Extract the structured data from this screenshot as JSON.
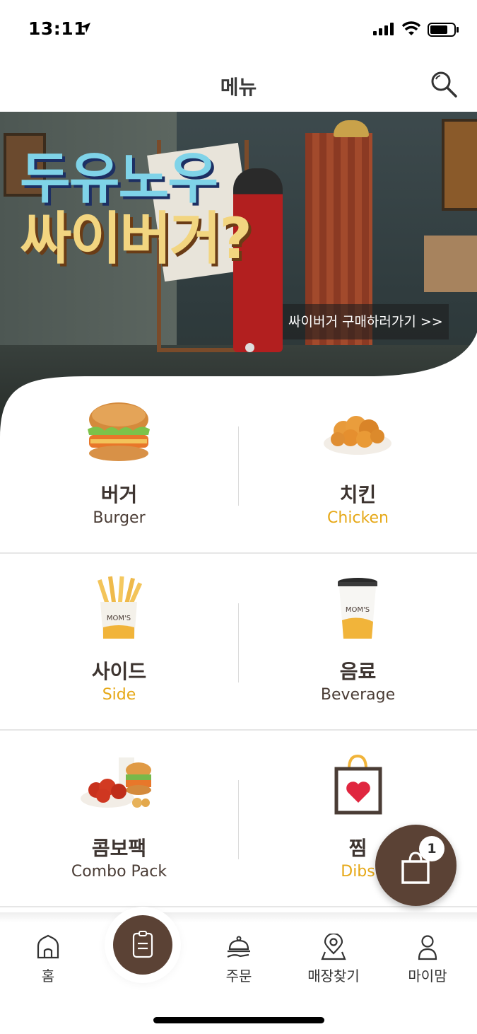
{
  "status_bar": {
    "time": "13:11"
  },
  "header": {
    "title": "메뉴",
    "search_icon": "search-icon"
  },
  "banner": {
    "headline_1": "두유노우",
    "headline_2": "싸이버거?",
    "cta": "싸이버거 구매하러가기 >>",
    "slide_indicator": "1"
  },
  "menu": {
    "rows": [
      [
        {
          "ko": "버거",
          "en": "Burger",
          "accent": false,
          "icon": "burger-image"
        },
        {
          "ko": "치킨",
          "en": "Chicken",
          "accent": true,
          "icon": "chicken-image"
        }
      ],
      [
        {
          "ko": "사이드",
          "en": "Side",
          "accent": true,
          "icon": "fries-image"
        },
        {
          "ko": "음료",
          "en": "Beverage",
          "accent": false,
          "icon": "beverage-image"
        }
      ],
      [
        {
          "ko": "콤보팩",
          "en": "Combo Pack",
          "accent": false,
          "icon": "combo-pack-image"
        },
        {
          "ko": "찜",
          "en": "Dibs",
          "accent": true,
          "icon": "dibs-heart-bag-icon"
        }
      ]
    ]
  },
  "cart": {
    "count": "1",
    "icon": "shopping-bag-icon"
  },
  "bottom_nav": {
    "items": [
      {
        "label": "홈",
        "icon": "home-icon"
      },
      {
        "label": "",
        "icon": "menu-clipboard-icon"
      },
      {
        "label": "주문",
        "icon": "order-cloche-icon"
      },
      {
        "label": "매장찾기",
        "icon": "store-locator-icon"
      },
      {
        "label": "마이맘",
        "icon": "profile-icon"
      }
    ]
  },
  "colors": {
    "brand_brown": "#5b4235",
    "accent_yellow": "#e6a817",
    "text_dark": "#3d3430"
  }
}
